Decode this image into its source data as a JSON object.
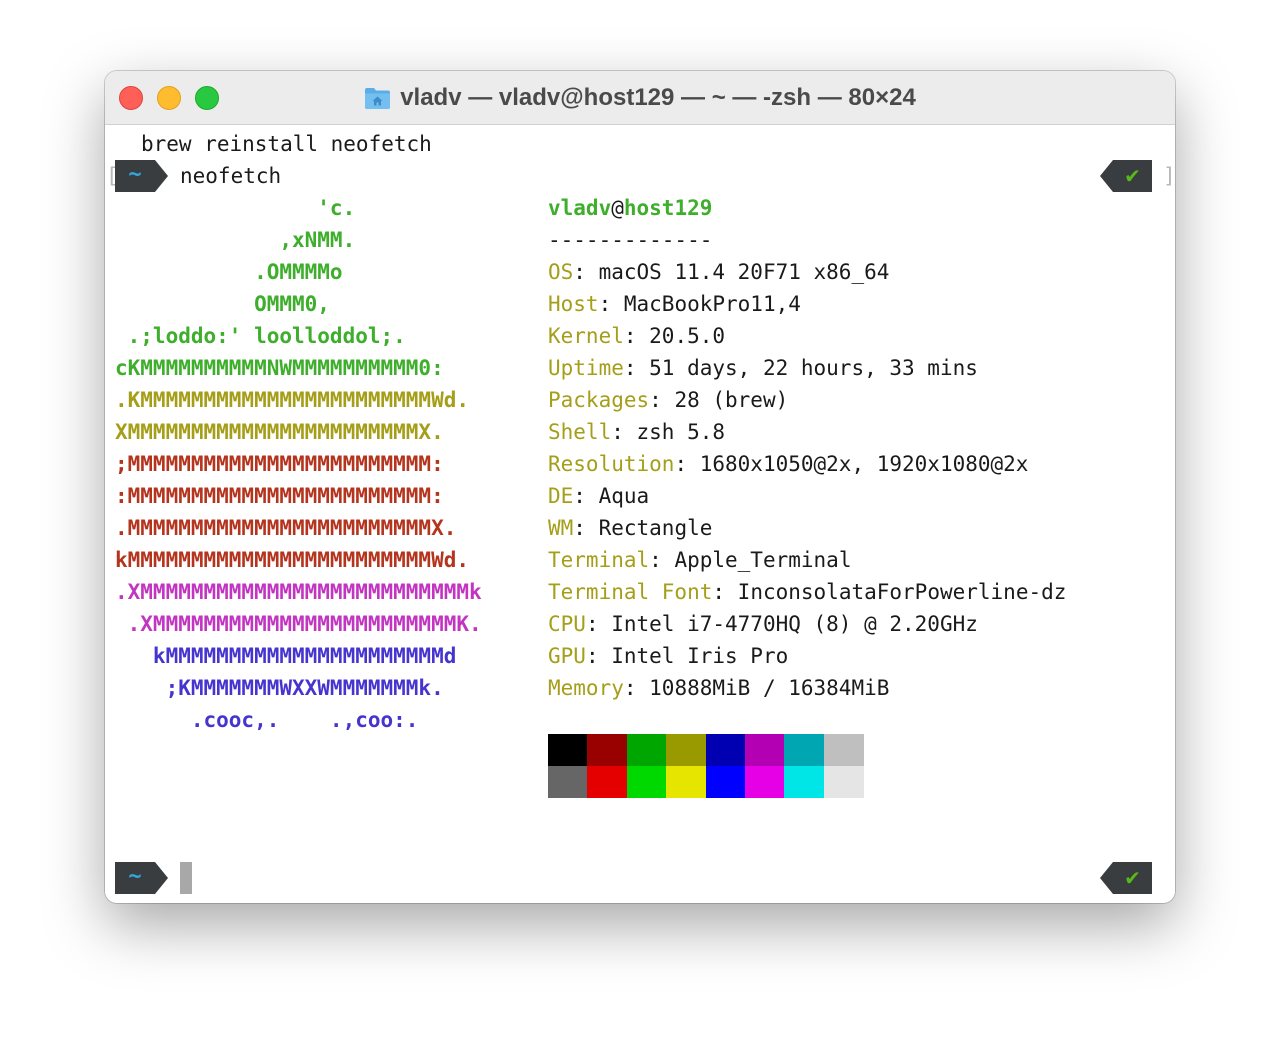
{
  "window": {
    "title": "vladv — vladv@host129 — ~ — -zsh — 80×24"
  },
  "terminal": {
    "history_command": "brew reinstall neofetch",
    "prompt_dir": "~",
    "prompt_status": "✔",
    "command": "neofetch",
    "bracket_left": "[",
    "bracket_right": "]",
    "user": "vladv",
    "at": "@",
    "host": "host129",
    "separator": "-------------",
    "logo_lines": [
      "                'c.",
      "             ,xNMM.",
      "           .OMMMMo",
      "           OMMM0,",
      " .;loddo:' loolloddol;.",
      "cKMMMMMMMMMMNWMMMMMMMMMM0:",
      ".KMMMMMMMMMMMMMMMMMMMMMMMWd.",
      "XMMMMMMMMMMMMMMMMMMMMMMMX.",
      ";MMMMMMMMMMMMMMMMMMMMMMMM:",
      ":MMMMMMMMMMMMMMMMMMMMMMMM:",
      ".MMMMMMMMMMMMMMMMMMMMMMMMX.",
      "kMMMMMMMMMMMMMMMMMMMMMMMMWd.",
      ".XMMMMMMMMMMMMMMMMMMMMMMMMMMk",
      " .XMMMMMMMMMMMMMMMMMMMMMMMMK.",
      "   kMMMMMMMMMMMMMMMMMMMMMMd",
      "    ;KMMMMMMMWXXWMMMMMMMk.",
      "      .cooc,.    .,coo:."
    ],
    "logo_colors": [
      "g",
      "g",
      "g",
      "g",
      "g",
      "g",
      "o",
      "o",
      "r",
      "r",
      "r",
      "r",
      "m",
      "m",
      "b",
      "b",
      "b"
    ],
    "info": [
      {
        "label": "OS",
        "value": "macOS 11.4 20F71 x86_64"
      },
      {
        "label": "Host",
        "value": "MacBookPro11,4"
      },
      {
        "label": "Kernel",
        "value": "20.5.0"
      },
      {
        "label": "Uptime",
        "value": "51 days, 22 hours, 33 mins"
      },
      {
        "label": "Packages",
        "value": "28 (brew)"
      },
      {
        "label": "Shell",
        "value": "zsh 5.8"
      },
      {
        "label": "Resolution",
        "value": "1680x1050@2x, 1920x1080@2x"
      },
      {
        "label": "DE",
        "value": "Aqua"
      },
      {
        "label": "WM",
        "value": "Rectangle"
      },
      {
        "label": "Terminal",
        "value": "Apple_Terminal"
      },
      {
        "label": "Terminal Font",
        "value": "InconsolataForPowerline-dz"
      },
      {
        "label": "CPU",
        "value": "Intel i7-4770HQ (8) @ 2.20GHz"
      },
      {
        "label": "GPU",
        "value": "Intel Iris Pro"
      },
      {
        "label": "Memory",
        "value": "10888MiB / 16384MiB"
      }
    ],
    "colon": ": ",
    "palette_row1": [
      "#000000",
      "#990000",
      "#00a600",
      "#999900",
      "#0000b2",
      "#b200b2",
      "#00a6b2",
      "#bfbfbf"
    ],
    "palette_row2": [
      "#666666",
      "#e50000",
      "#00d900",
      "#e5e500",
      "#0000ff",
      "#e500e5",
      "#00e5e5",
      "#e5e5e5"
    ]
  },
  "colors": {
    "green": "#3eae2c",
    "olive": "#a59e19",
    "red": "#b4341e",
    "magenta": "#c235c1",
    "blue": "#4634cf",
    "prompt_bg": "#3a3d3f",
    "prompt_dir": "#32a7df",
    "prompt_ok": "#58b91b"
  },
  "icons": {
    "folder": "home-folder-icon",
    "status": "checkmark-icon"
  }
}
